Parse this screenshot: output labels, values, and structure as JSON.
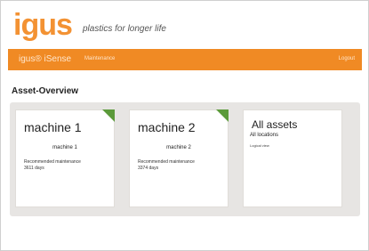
{
  "brand": {
    "logo": "igus",
    "tagline": "plastics for longer life"
  },
  "nav": {
    "title": "igus® iSense",
    "link": "Maintenance",
    "logout": "Logout"
  },
  "page": {
    "heading": "Asset-Overview"
  },
  "cards": [
    {
      "title": "machine 1",
      "name": "machine 1",
      "maintenance_label": "Recommended maintenance",
      "days": "3611 days",
      "status_color": "#5b9a3a"
    },
    {
      "title": "machine 2",
      "name": "machine 2",
      "maintenance_label": "Recommended maintenance",
      "days": "3374 days",
      "status_color": "#5b9a3a"
    },
    {
      "title": "All assets",
      "subtitle": "All locations",
      "logical": "Logical view"
    }
  ]
}
